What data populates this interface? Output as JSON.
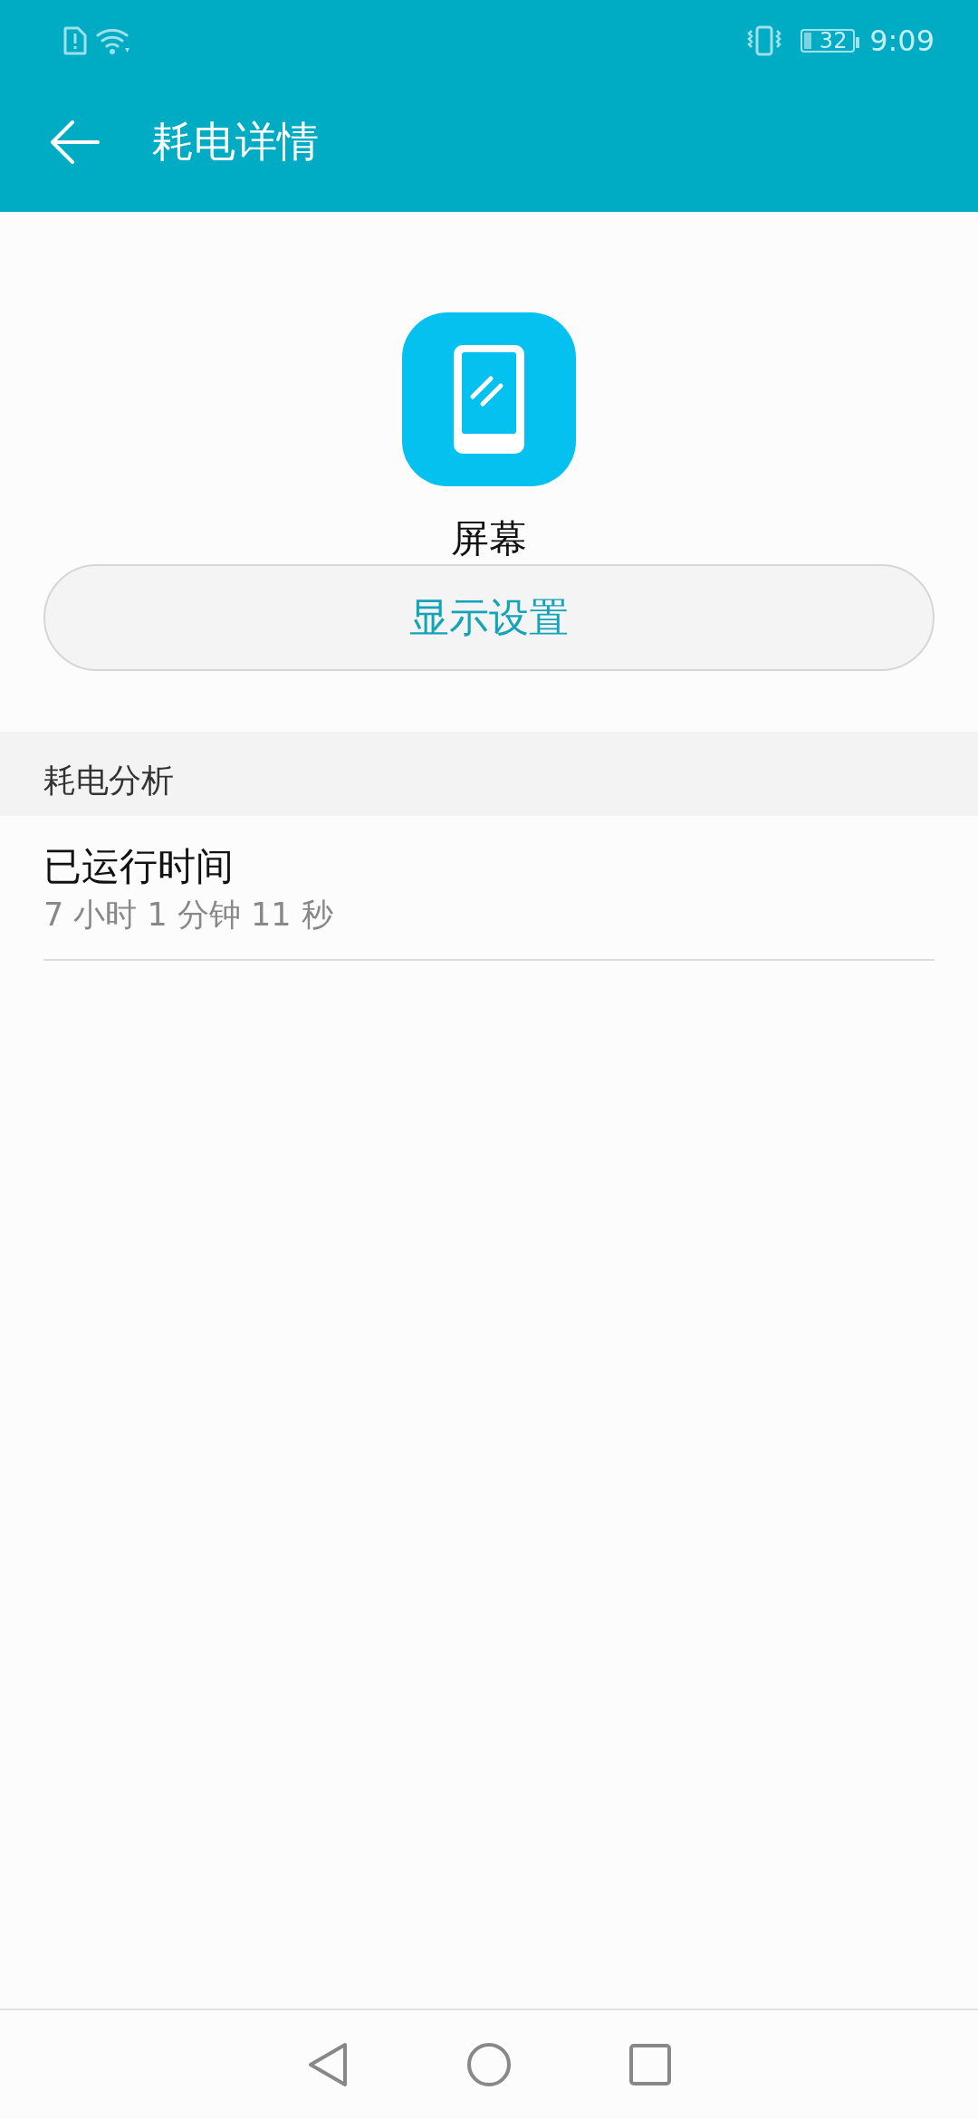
{
  "status_bar": {
    "battery": "32",
    "time": "9:09"
  },
  "app_bar": {
    "title": "耗电详情"
  },
  "item": {
    "name": "屏幕",
    "button": "显示设置"
  },
  "section": {
    "title": "耗电分析"
  },
  "rows": [
    {
      "title": "已运行时间",
      "subtitle": "7 小时 1 分钟 11 秒"
    }
  ]
}
